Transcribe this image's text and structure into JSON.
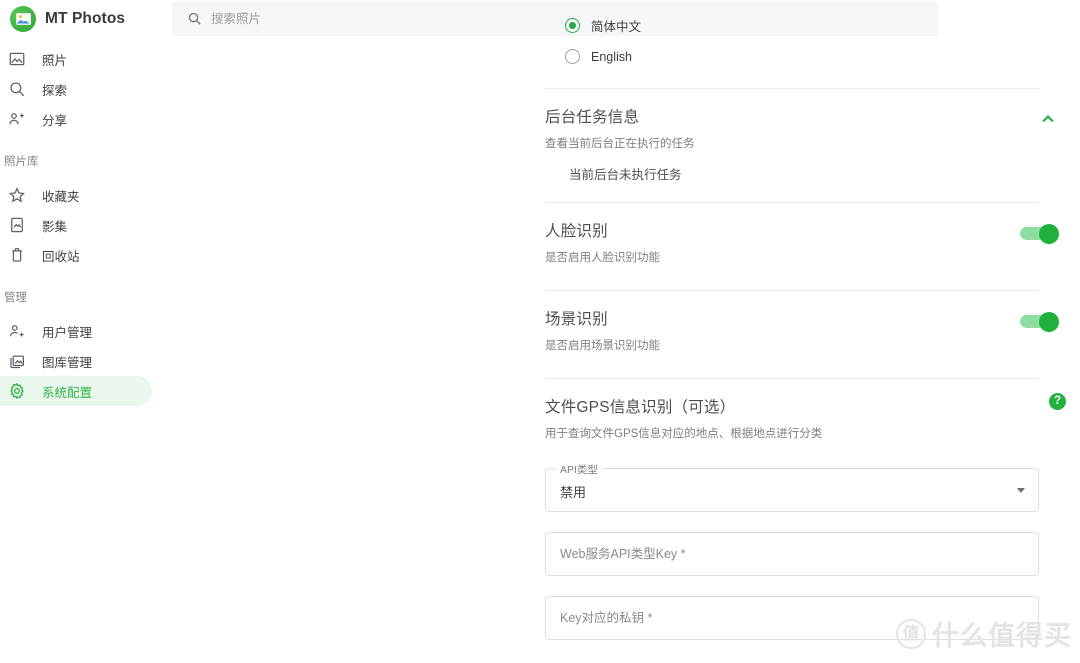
{
  "app": {
    "brand_name": "MT Photos",
    "logo_icon": "photo-logo-icon"
  },
  "search": {
    "placeholder": "搜索照片",
    "value": "",
    "icon": "search-icon"
  },
  "sidebar": {
    "primary_items": [
      {
        "label": "照片",
        "icon": "photo-icon",
        "active": false
      },
      {
        "label": "探索",
        "icon": "search-icon",
        "active": false
      },
      {
        "label": "分享",
        "icon": "people-share-icon",
        "active": false
      }
    ],
    "library_group_title": "照片库",
    "library_items": [
      {
        "label": "收藏夹",
        "icon": "star-icon",
        "active": false
      },
      {
        "label": "影集",
        "icon": "album-icon",
        "active": false
      },
      {
        "label": "回收站",
        "icon": "trash-icon",
        "active": false
      }
    ],
    "manage_group_title": "管理",
    "manage_items": [
      {
        "label": "用户管理",
        "icon": "user-manage-icon",
        "active": false
      },
      {
        "label": "图库管理",
        "icon": "library-manage-icon",
        "active": false
      },
      {
        "label": "系统配置",
        "icon": "gear-icon",
        "active": true
      }
    ]
  },
  "main": {
    "language": {
      "options": [
        {
          "label": "简体中文",
          "selected": true
        },
        {
          "label": "English",
          "selected": false
        }
      ]
    },
    "background_tasks": {
      "title": "后台任务信息",
      "subtitle": "查看当前后台正在执行的任务",
      "body": "当前后台未执行任务",
      "collapse_icon": "chevron-up-icon"
    },
    "face_recognition": {
      "title": "人脸识别",
      "subtitle": "是否启用人脸识别功能",
      "enabled": true
    },
    "scene_recognition": {
      "title": "场景识别",
      "subtitle": "是否启用场景识别功能",
      "enabled": true
    },
    "gps": {
      "title": "文件GPS信息识别（可选）",
      "subtitle": "用于查询文件GPS信息对应的地点、根据地点进行分类",
      "help_icon": "question-mark-icon",
      "api_type_label": "API类型",
      "api_type_value": "禁用",
      "api_key_placeholder": "Web服务API类型Key *",
      "api_key_value": "",
      "secret_placeholder": "Key对应的私钥 *",
      "secret_value": ""
    }
  },
  "watermark": {
    "mark": "值",
    "text": "什么值得买"
  },
  "colors": {
    "accent_green": "#26b14a",
    "active_pill": "#e9f7ec",
    "divider": "#e8eaed",
    "search_bg": "#f5f6f7"
  }
}
